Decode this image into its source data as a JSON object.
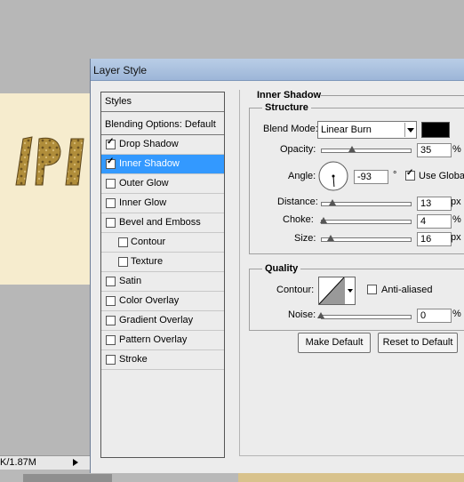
{
  "statusbar": {
    "text": "K/1.87M"
  },
  "dialog": {
    "title": "Layer Style",
    "styles": [
      {
        "label": "Styles",
        "checkbox": false,
        "checked": false,
        "selected": false,
        "indent": false,
        "header": true
      },
      {
        "label": "Blending Options: Default",
        "checkbox": false,
        "checked": false,
        "selected": false,
        "indent": false,
        "header": true
      },
      {
        "label": "Drop Shadow",
        "checkbox": true,
        "checked": true,
        "selected": false,
        "indent": false
      },
      {
        "label": "Inner Shadow",
        "checkbox": true,
        "checked": true,
        "selected": true,
        "indent": false
      },
      {
        "label": "Outer Glow",
        "checkbox": true,
        "checked": false,
        "selected": false,
        "indent": false
      },
      {
        "label": "Inner Glow",
        "checkbox": true,
        "checked": false,
        "selected": false,
        "indent": false
      },
      {
        "label": "Bevel and Emboss",
        "checkbox": true,
        "checked": false,
        "selected": false,
        "indent": false
      },
      {
        "label": "Contour",
        "checkbox": true,
        "checked": false,
        "selected": false,
        "indent": true
      },
      {
        "label": "Texture",
        "checkbox": true,
        "checked": false,
        "selected": false,
        "indent": true
      },
      {
        "label": "Satin",
        "checkbox": true,
        "checked": false,
        "selected": false,
        "indent": false
      },
      {
        "label": "Color Overlay",
        "checkbox": true,
        "checked": false,
        "selected": false,
        "indent": false
      },
      {
        "label": "Gradient Overlay",
        "checkbox": true,
        "checked": false,
        "selected": false,
        "indent": false
      },
      {
        "label": "Pattern Overlay",
        "checkbox": true,
        "checked": false,
        "selected": false,
        "indent": false
      },
      {
        "label": "Stroke",
        "checkbox": true,
        "checked": false,
        "selected": false,
        "indent": false
      }
    ],
    "panel": {
      "heading": "Inner Shadow",
      "structure": {
        "title": "Structure",
        "blend_mode_label": "Blend Mode:",
        "blend_mode_value": "Linear Burn",
        "shadow_color": "#000000",
        "opacity_label": "Opacity:",
        "opacity_value": "35",
        "opacity_unit": "%",
        "opacity_fraction": 0.35,
        "angle_label": "Angle:",
        "angle_value": "-93",
        "angle_unit": "°",
        "use_global_light_label": "Use Global Light",
        "use_global_light_checked": true,
        "distance_label": "Distance:",
        "distance_value": "13",
        "distance_unit": "px",
        "choke_label": "Choke:",
        "choke_value": "4",
        "choke_unit": "%",
        "size_label": "Size:",
        "size_value": "16",
        "size_unit": "px"
      },
      "quality": {
        "title": "Quality",
        "contour_label": "Contour:",
        "anti_aliased_label": "Anti-aliased",
        "anti_aliased_checked": false,
        "noise_label": "Noise:",
        "noise_value": "0",
        "noise_unit": "%"
      },
      "make_default_label": "Make Default",
      "reset_default_label": "Reset to Default"
    }
  }
}
